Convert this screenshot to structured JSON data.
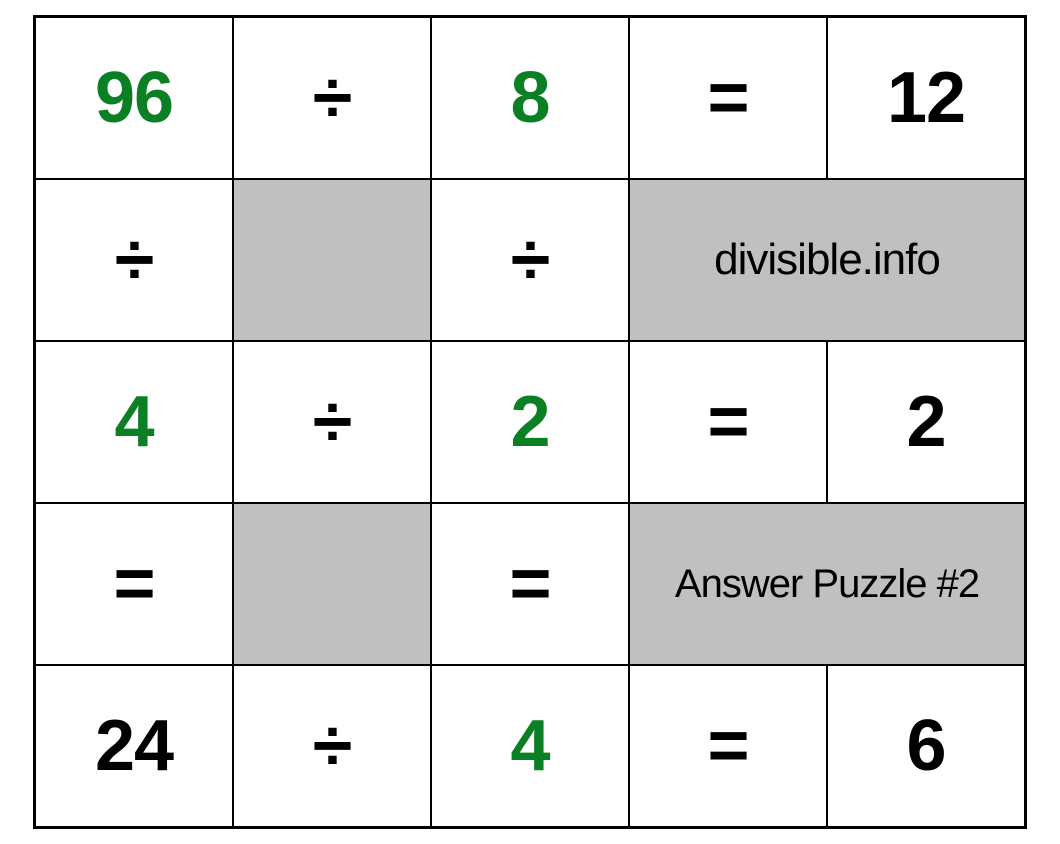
{
  "grid": {
    "r0": {
      "c0": "96",
      "c1": "÷",
      "c2": "8",
      "c3": "=",
      "c4": "12"
    },
    "r1": {
      "c0": "÷",
      "c2": "÷",
      "info": "divisible.info"
    },
    "r2": {
      "c0": "4",
      "c1": "÷",
      "c2": "2",
      "c3": "=",
      "c4": "2"
    },
    "r3": {
      "c0": "=",
      "c2": "=",
      "info": "Answer Puzzle #2"
    },
    "r4": {
      "c0": "24",
      "c1": "÷",
      "c2": "4",
      "c3": "=",
      "c4": "6"
    }
  }
}
